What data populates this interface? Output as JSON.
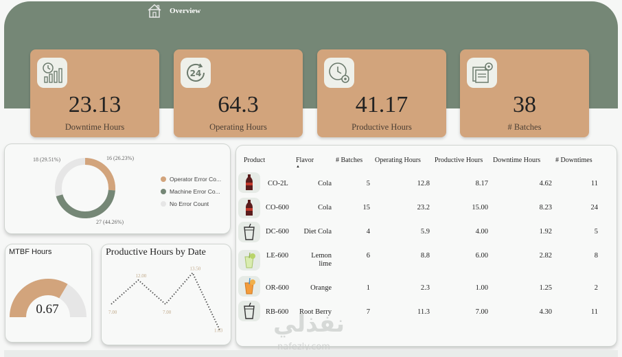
{
  "nav": {
    "title": "Overview",
    "icon": "home-icon"
  },
  "kpis": [
    {
      "value": "23.13",
      "label": "Downtime Hours",
      "icon": "chart-clock-icon"
    },
    {
      "value": "64.3",
      "label": "Operating Hours",
      "icon": "24-hours-icon"
    },
    {
      "value": "41.17",
      "label": "Productive Hours",
      "icon": "clock-gear-icon"
    },
    {
      "value": "38",
      "label": "# Batches",
      "icon": "batches-icon"
    }
  ],
  "donut": {
    "labels": {
      "a": "16 (26.23%)",
      "b": "27 (44.26%)",
      "c": "18 (29.51%)"
    },
    "legend": [
      {
        "label": "Operator Error Co...",
        "color": "#d2a47c"
      },
      {
        "label": "Machine Error Co...",
        "color": "#758776"
      },
      {
        "label": "No Error Count",
        "color": "#e6e6e6"
      }
    ]
  },
  "mtbf": {
    "title": "MTBF Hours",
    "value": "0.67",
    "level": 0.67
  },
  "line_chart": {
    "title": "Productive Hours by Date",
    "points": [
      {
        "label": "7.00",
        "value": 7.0
      },
      {
        "label": "12.00",
        "value": 12.0
      },
      {
        "label": "7.00",
        "value": 7.0
      },
      {
        "label": "13.50",
        "value": 13.5
      },
      {
        "label": "1.63",
        "value": 1.63
      }
    ]
  },
  "table": {
    "headers": {
      "product": "Product",
      "flavor": "Flavor",
      "batches": "# Batches",
      "operating": "Operating Hours",
      "productive": "Productive Hours",
      "downtime": "Downtime Hours",
      "downtimes": "# Downtimes"
    },
    "rows": [
      {
        "product": "CO-2L",
        "flavor": "Cola",
        "batches": "5",
        "operating": "12.8",
        "productive": "8.17",
        "downtime": "4.62",
        "downtimes": "11"
      },
      {
        "product": "CO-600",
        "flavor": "Cola",
        "batches": "15",
        "operating": "23.2",
        "productive": "15.00",
        "downtime": "8.23",
        "downtimes": "24"
      },
      {
        "product": "DC-600",
        "flavor": "Diet Cola",
        "batches": "4",
        "operating": "5.9",
        "productive": "4.00",
        "downtime": "1.92",
        "downtimes": "5"
      },
      {
        "product": "LE-600",
        "flavor": "Lemon lime",
        "batches": "6",
        "operating": "8.8",
        "productive": "6.00",
        "downtime": "2.82",
        "downtimes": "8"
      },
      {
        "product": "OR-600",
        "flavor": "Orange",
        "batches": "1",
        "operating": "2.3",
        "productive": "1.00",
        "downtime": "1.25",
        "downtimes": "2"
      },
      {
        "product": "RB-600",
        "flavor": "Root Berry",
        "batches": "7",
        "operating": "11.3",
        "productive": "7.00",
        "downtime": "4.30",
        "downtimes": "11"
      }
    ]
  },
  "watermark": {
    "arabic": "نفذلي",
    "latin": "nafezly.com"
  }
}
